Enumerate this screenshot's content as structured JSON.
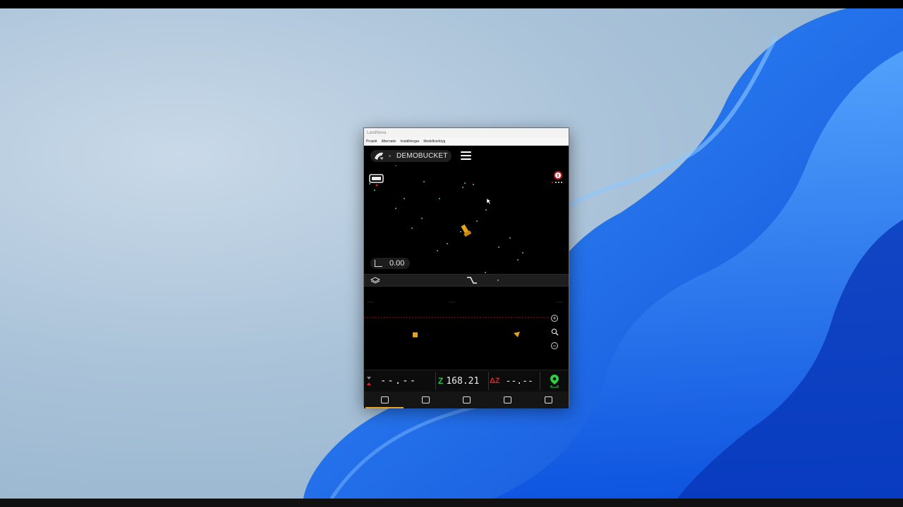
{
  "window": {
    "title": "LandNova",
    "menu": [
      "Projekt",
      "Alternativ",
      "Inställningar",
      "Modellverktyg"
    ]
  },
  "header": {
    "project_name": "DEMOBUCKET",
    "menu_icon": "hamburger-icon"
  },
  "plan_view": {
    "level_value": "0.00",
    "left_icon": "machine-view-icon",
    "right_icon": "info-icon"
  },
  "section_view": {
    "zoom_in": "+",
    "zoom_out": "−"
  },
  "status": {
    "cut_fill_value": "--.--",
    "z_label": "Z",
    "z_value": "168.21",
    "dz_label": "ΔZ",
    "dz_value": "--.--",
    "gps_icon": "gps-pin-icon"
  },
  "tabs": [
    {
      "icon": "plan-view-icon",
      "active": true
    },
    {
      "icon": "profile-view-icon",
      "active": false
    },
    {
      "icon": "point-view-icon",
      "active": false
    },
    {
      "icon": "image-view-icon",
      "active": false
    },
    {
      "icon": "location-view-icon",
      "active": false
    }
  ],
  "colors": {
    "accent": "#e5a21a",
    "gps_green": "#2ecc40",
    "z_green": "#27c93f",
    "dz_red": "#e02020",
    "point_teal": "#3fc8a8"
  }
}
